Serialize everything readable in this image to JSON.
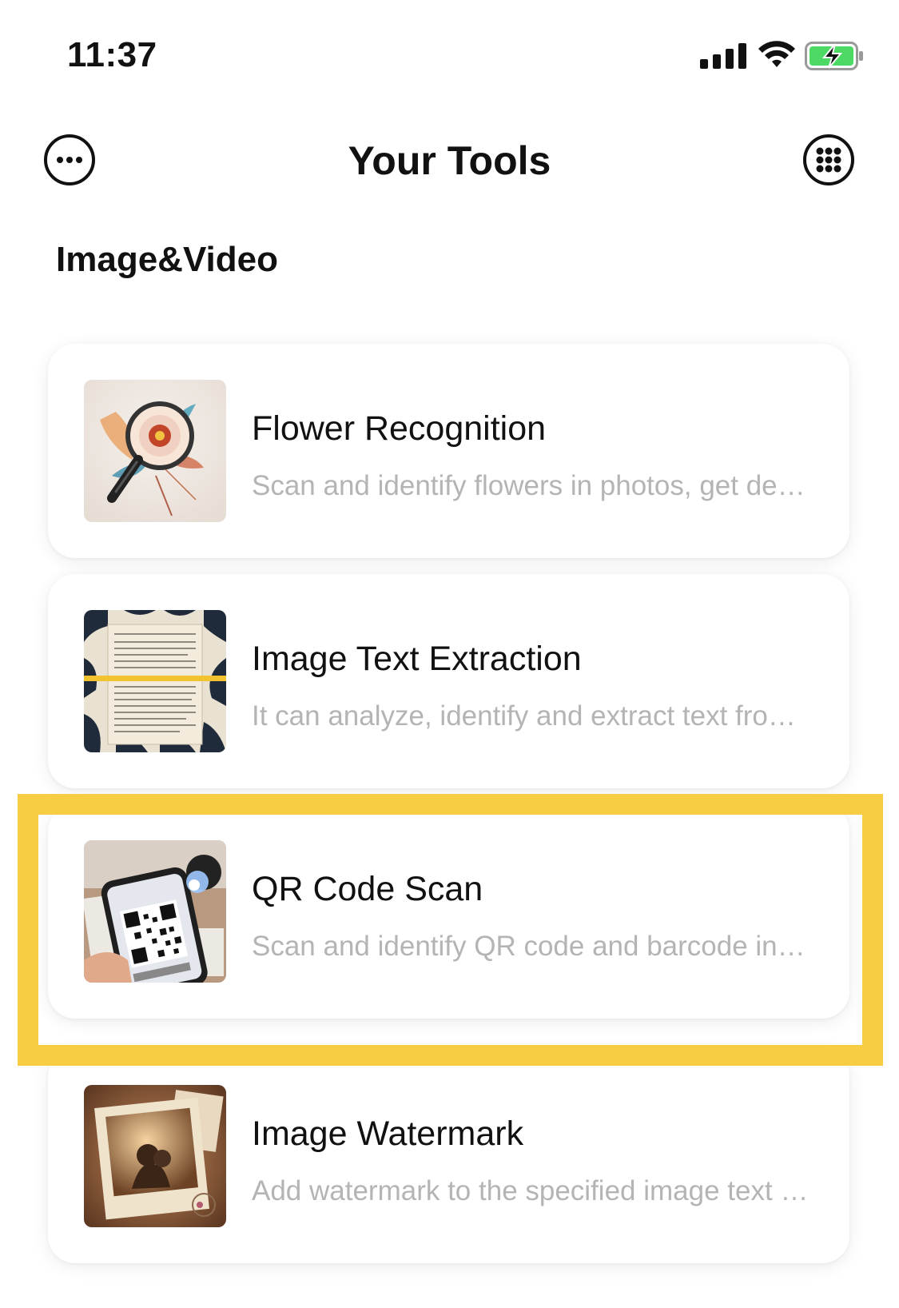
{
  "status_bar": {
    "time": "11:37",
    "icons": [
      "cellular-signal-icon",
      "wifi-icon",
      "battery-charging-icon"
    ],
    "battery_color": "#4cd964"
  },
  "header": {
    "title": "Your Tools",
    "left_icon": "more-dots-icon",
    "right_icon": "grid-apps-icon"
  },
  "section": {
    "title": "Image&Video"
  },
  "tools": [
    {
      "title": "Flower Recognition",
      "description": "Scan and identify flowers in photos, get detailed information",
      "icon": "flower-magnifier-thumbnail"
    },
    {
      "title": "Image Text Extraction",
      "description": "It can analyze, identify and extract text from images",
      "icon": "document-scan-thumbnail"
    },
    {
      "title": "QR Code Scan",
      "description": "Scan and identify QR code and barcode information",
      "icon": "qr-phone-thumbnail",
      "highlighted": true
    },
    {
      "title": "Image Watermark",
      "description": "Add watermark to the specified image text or logo",
      "icon": "vintage-photo-thumbnail"
    }
  ],
  "colors": {
    "highlight": "#f7cd44",
    "title_text": "#111111",
    "desc_text": "#b4b4b4"
  }
}
